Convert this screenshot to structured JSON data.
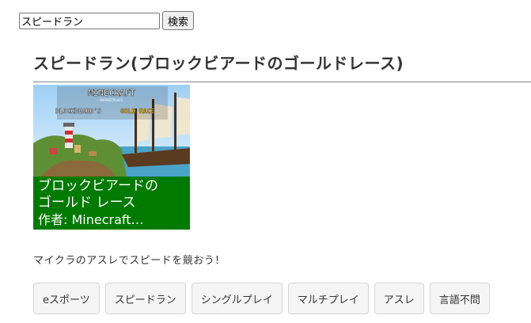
{
  "search": {
    "value": "スピードラン",
    "button_label": "検索"
  },
  "page_title": "スピードラン(ブロックビアードのゴールドレース)",
  "card": {
    "logo_text": "MINECRAFT",
    "logo_sub": "MARKETPLACE",
    "banner_text_left": "BLOCKBEARD'S",
    "banner_text_right": "GOLD RACE",
    "caption_line1": "ブロックビアードの",
    "caption_line2": "ゴールド レース",
    "caption_author": "作者: Minecraft…",
    "colors": {
      "caption_bg": "#007a00"
    }
  },
  "description": "マイクラのアスレでスピードを競おう！",
  "tags": [
    "eスポーツ",
    "スピードラン",
    "シングルプレイ",
    "マルチプレイ",
    "アスレ",
    "言語不問"
  ]
}
